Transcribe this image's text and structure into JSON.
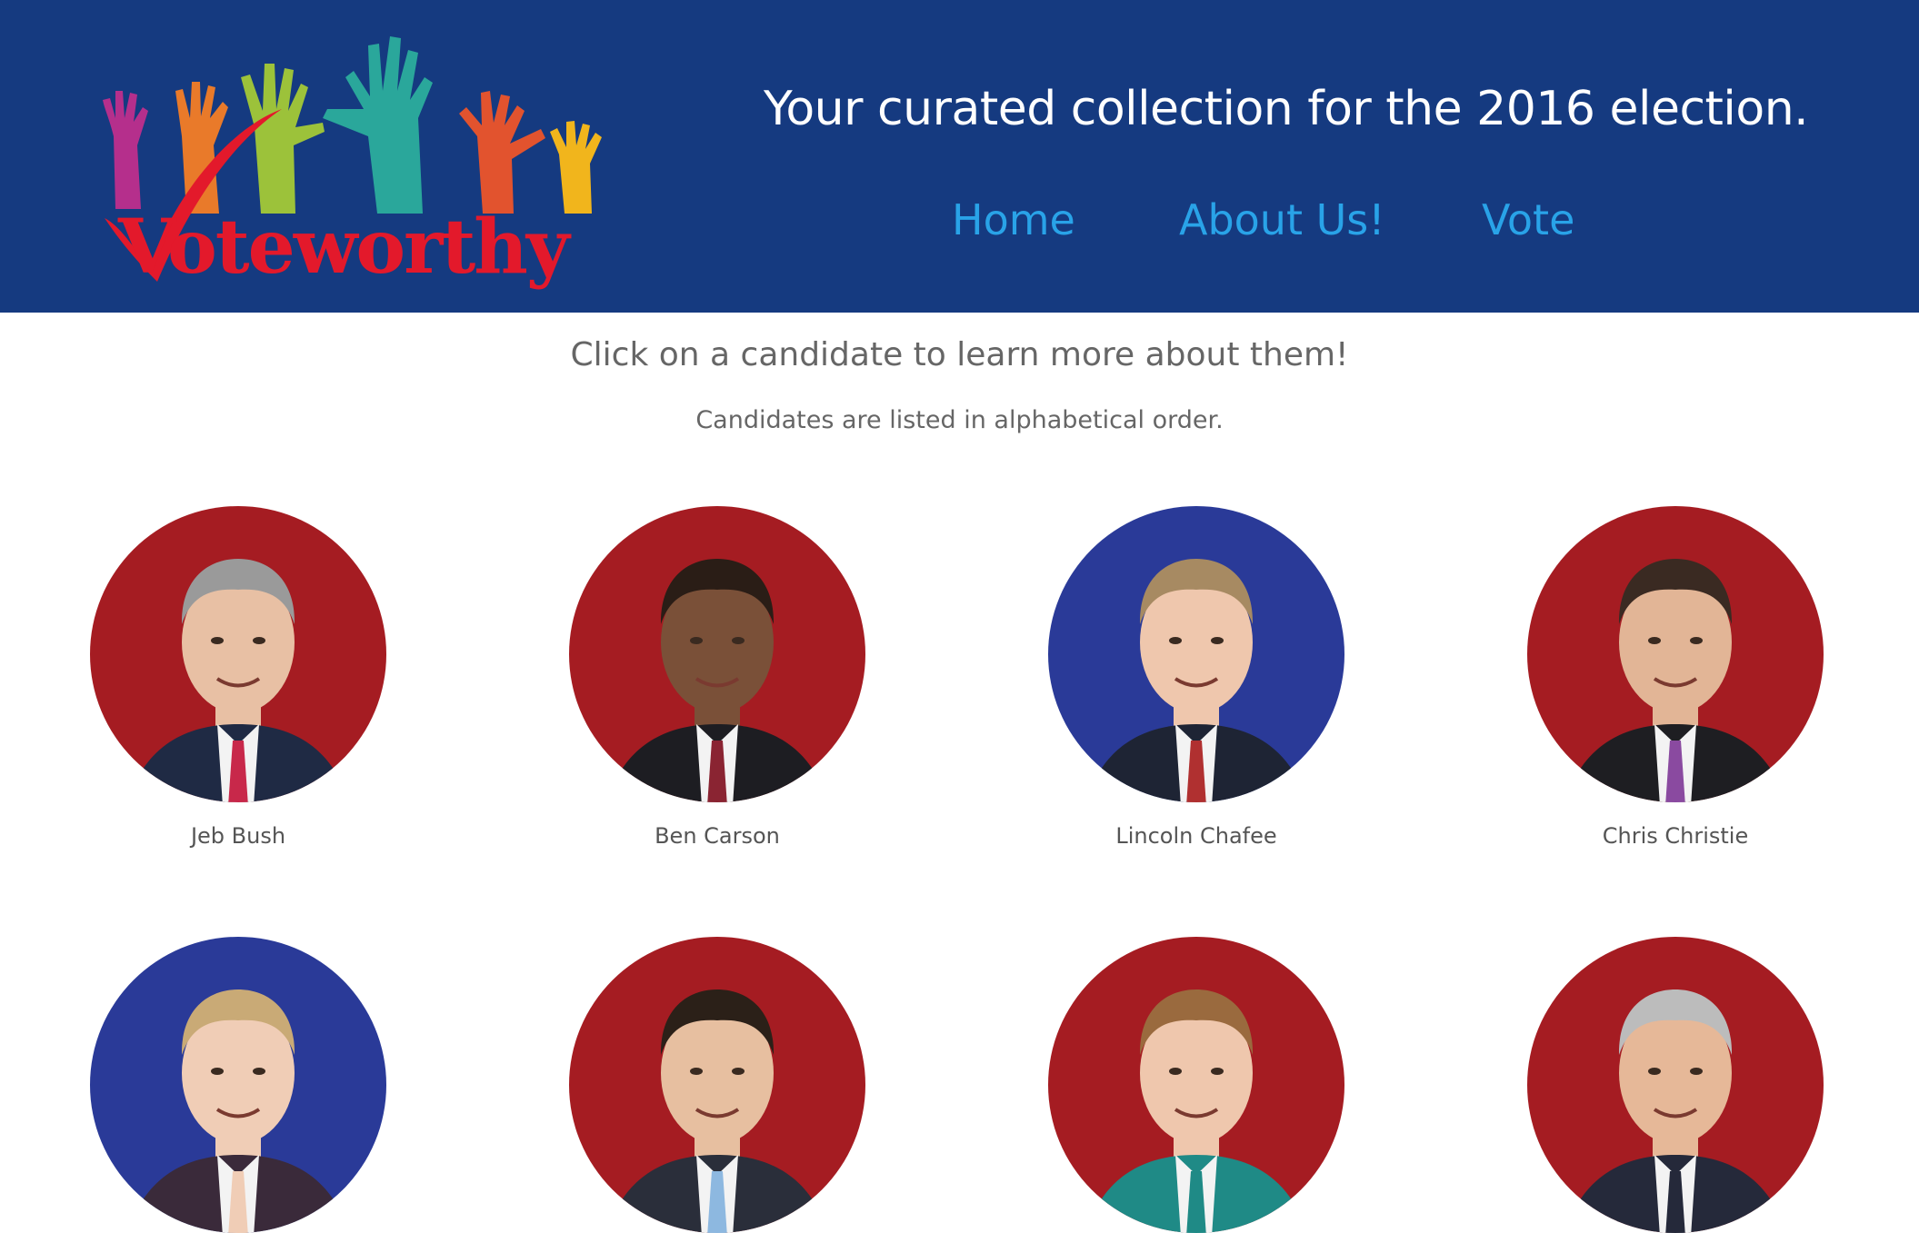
{
  "header": {
    "logo_text": "Voteworthy",
    "tagline": "Your curated collection for the 2016 election.",
    "nav": [
      {
        "label": "Home"
      },
      {
        "label": "About Us!"
      },
      {
        "label": "Vote"
      }
    ]
  },
  "main": {
    "intro": "Click on a candidate to learn more about them!",
    "subintro": "Candidates are listed in alphabetical order."
  },
  "candidates": [
    {
      "name": "Jeb Bush",
      "bg": "red"
    },
    {
      "name": "Ben Carson",
      "bg": "red"
    },
    {
      "name": "Lincoln Chafee",
      "bg": "blue"
    },
    {
      "name": "Chris Christie",
      "bg": "red"
    },
    {
      "name": "",
      "bg": "blue"
    },
    {
      "name": "",
      "bg": "red"
    },
    {
      "name": "",
      "bg": "red"
    },
    {
      "name": "",
      "bg": "red"
    }
  ],
  "colors": {
    "header_bg": "#153a80",
    "nav_link": "#29a3e8",
    "party_red": "#a51c22",
    "party_blue": "#2a3a98",
    "logo_red": "#e3192b"
  }
}
